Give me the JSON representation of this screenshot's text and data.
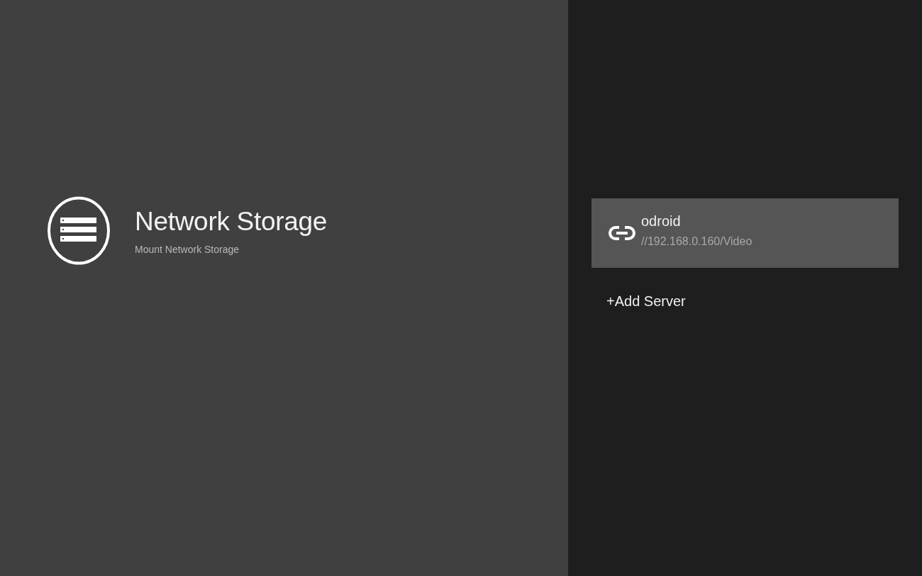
{
  "header": {
    "title": "Network Storage",
    "subtitle": "Mount Network Storage"
  },
  "servers": [
    {
      "name": "odroid",
      "path": "//192.168.0.160/Video",
      "selected": true
    }
  ],
  "add_button": {
    "label": "+Add Server"
  }
}
